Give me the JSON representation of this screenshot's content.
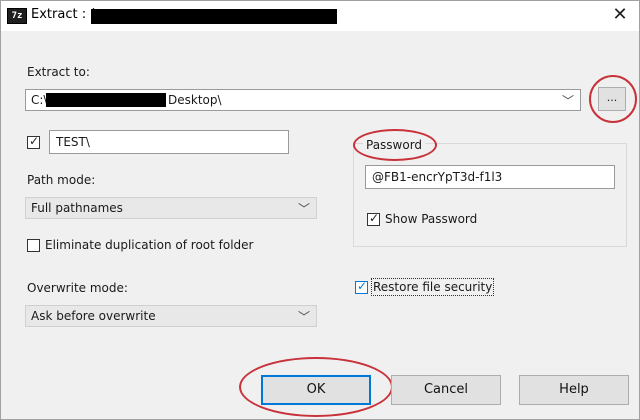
{
  "window": {
    "app_icon": "7z",
    "title": "Extract : ("
  },
  "extract_to": {
    "label": "Extract to:",
    "path_prefix": "C:\\",
    "path_suffix": "Desktop\\",
    "browse_label": "..."
  },
  "subfolder": {
    "checked": true,
    "value": "TEST\\"
  },
  "path_mode": {
    "label": "Path mode:",
    "value": "Full pathnames"
  },
  "eliminate_duplication": {
    "label": "Eliminate duplication of root folder",
    "checked": false
  },
  "overwrite_mode": {
    "label": "Overwrite mode:",
    "value": "Ask before overwrite"
  },
  "password": {
    "label": "Password",
    "value": "@FB1-encrYpT3d-f1l3",
    "show_label": "Show Password",
    "show_checked": true
  },
  "restore_security": {
    "label": "Restore file security",
    "checked": true
  },
  "buttons": {
    "ok": "OK",
    "cancel": "Cancel",
    "help": "Help"
  },
  "icons": {
    "close": "close-icon",
    "chevron": "chevron-down-icon",
    "check": "checkmark-icon"
  },
  "colors": {
    "annotation": "#c8323a",
    "focus": "#0078d7"
  }
}
